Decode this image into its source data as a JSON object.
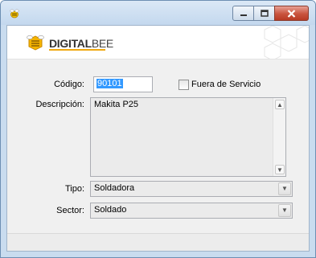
{
  "window": {
    "title": ""
  },
  "brand": {
    "bold": "DIGITAL",
    "light": "BEE"
  },
  "form": {
    "codigo_label": "Código:",
    "codigo_value": "90101",
    "fuera_label": "Fuera de Servicio",
    "fuera_checked": false,
    "descripcion_label": "Descripción:",
    "descripcion_value": "Makita P25",
    "tipo_label": "Tipo:",
    "tipo_value": "Soldadora",
    "sector_label": "Sector:",
    "sector_value": "Soldado"
  },
  "icons": {
    "app": "bee-icon",
    "minimize": "minimize-icon",
    "maximize": "maximize-icon",
    "close": "close-icon"
  }
}
